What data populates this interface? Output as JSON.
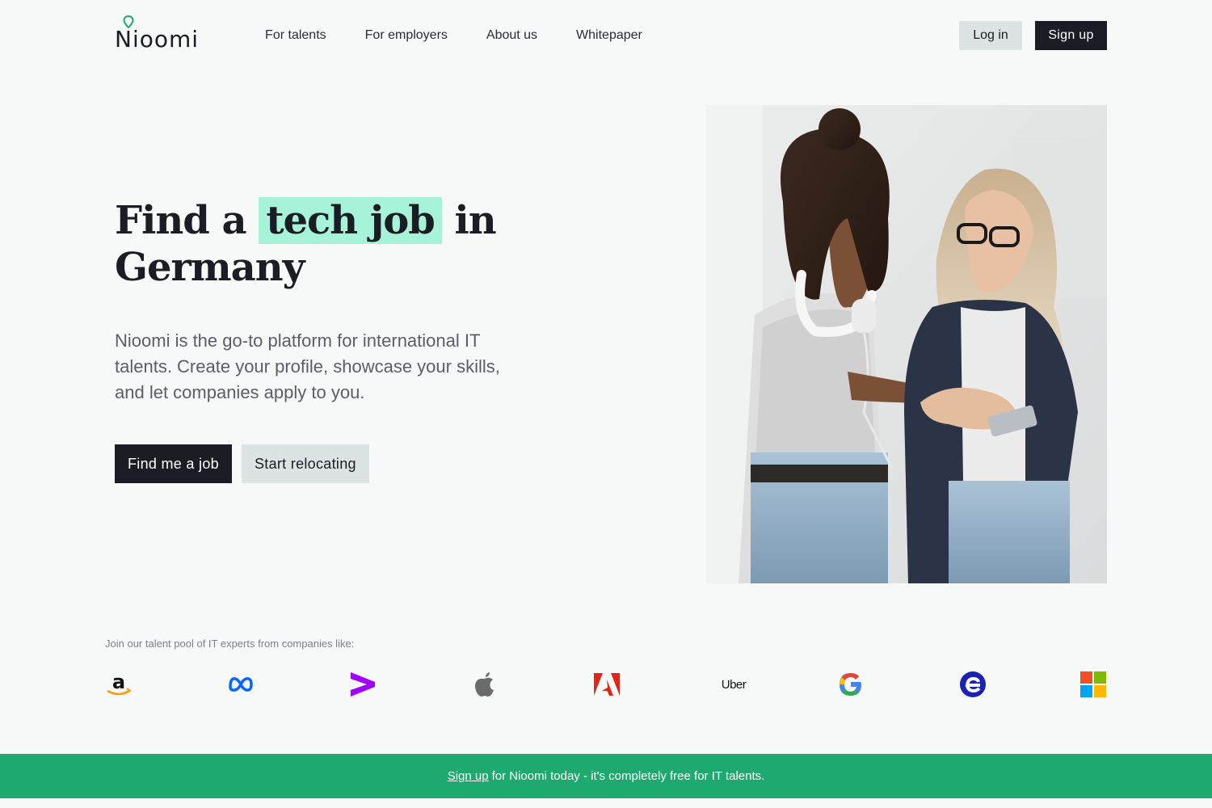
{
  "brand": {
    "name": "Nioomi",
    "accent": "#1eaa6e",
    "highlight": "#a7f3da",
    "dark": "#1a1d24"
  },
  "nav": {
    "items": [
      "For talents",
      "For employers",
      "About us",
      "Whitepaper"
    ]
  },
  "auth": {
    "login": "Log in",
    "signup": "Sign up"
  },
  "hero": {
    "title_before": "Find a",
    "title_highlight": "tech job",
    "title_after": "in Germany",
    "description": "Nioomi is the go-to platform for international IT talents. Create your profile, showcase your skills, and let companies apply to you.",
    "primary_cta": "Find me a job",
    "secondary_cta": "Start relocating"
  },
  "companies": {
    "label": "Join our talent pool of IT experts from companies like:",
    "logos": [
      "amazon-logo-icon",
      "meta-logo-icon",
      "accenture-logo-icon",
      "apple-logo-icon",
      "adobe-logo-icon",
      "uber-logo-icon",
      "google-logo-icon",
      "e-logo-icon",
      "microsoft-logo-icon"
    ],
    "uber_text": "Uber"
  },
  "footer_banner": {
    "link": "Sign up",
    "text": "for Nioomi today - it's completely free for IT talents."
  }
}
